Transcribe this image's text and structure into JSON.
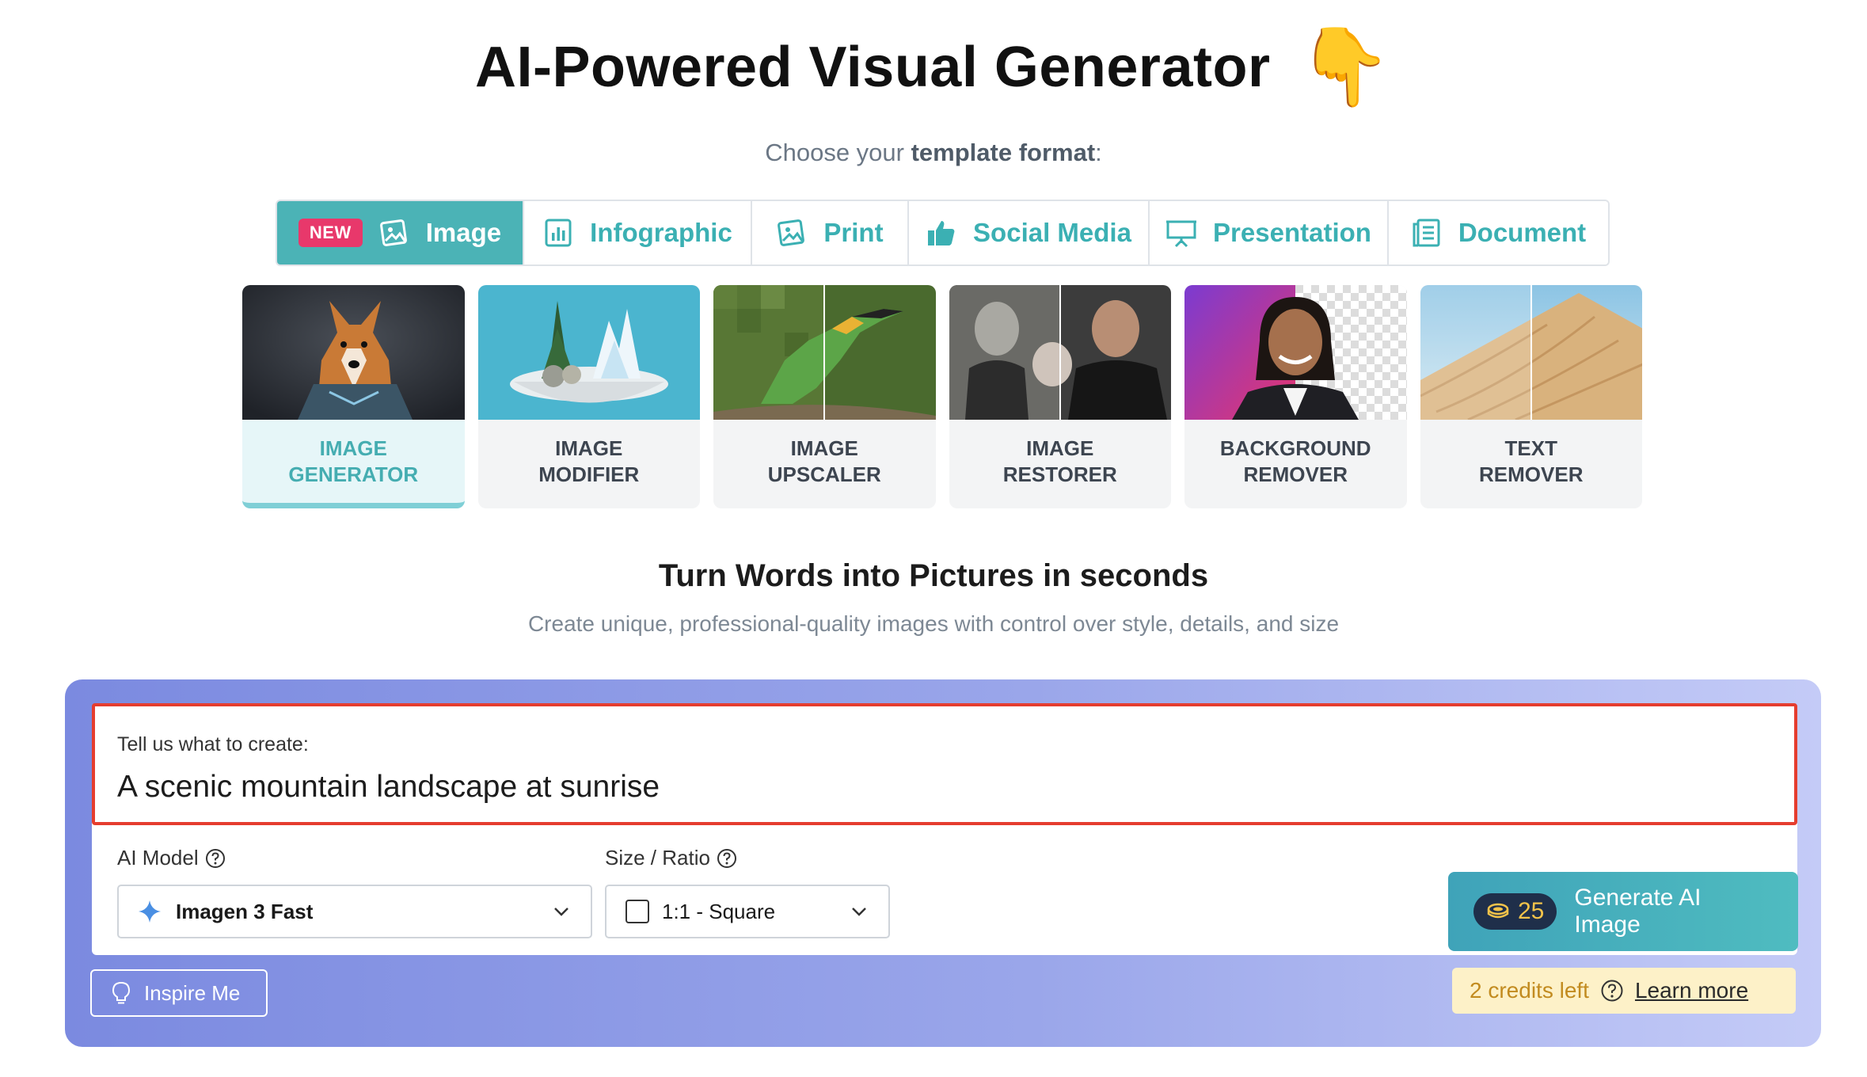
{
  "header": {
    "title": "AI-Powered Visual Generator",
    "pointer_emoji": "👇",
    "choose_prefix": "Choose your ",
    "choose_bold": "template format",
    "choose_suffix": ":"
  },
  "formats": [
    {
      "label": "Image",
      "icon": "image-icon",
      "badge": "NEW",
      "active": true
    },
    {
      "label": "Infographic",
      "icon": "bar-chart-icon"
    },
    {
      "label": "Print",
      "icon": "print-icon"
    },
    {
      "label": "Social Media",
      "icon": "thumbs-up-icon"
    },
    {
      "label": "Presentation",
      "icon": "presentation-icon"
    },
    {
      "label": "Document",
      "icon": "document-icon"
    }
  ],
  "tools": [
    {
      "label_line1": "IMAGE",
      "label_line2": "GENERATOR",
      "active": true
    },
    {
      "label_line1": "IMAGE",
      "label_line2": "MODIFIER"
    },
    {
      "label_line1": "IMAGE",
      "label_line2": "UPSCALER"
    },
    {
      "label_line1": "IMAGE",
      "label_line2": "RESTORER"
    },
    {
      "label_line1": "BACKGROUND",
      "label_line2": "REMOVER"
    },
    {
      "label_line1": "TEXT",
      "label_line2": "REMOVER"
    }
  ],
  "hero": {
    "title": "Turn Words into Pictures in seconds",
    "subtitle": "Create unique, professional-quality images with control over style, details, and size"
  },
  "form": {
    "prompt_label": "Tell us what to create:",
    "prompt_value": "A scenic mountain landscape at sunrise",
    "model_label": "AI Model",
    "model_value": "Imagen 3 Fast",
    "ratio_label": "Size / Ratio",
    "ratio_value": "1:1 - Square",
    "generate_cost": "25",
    "generate_label": "Generate AI Image",
    "inspire_label": "Inspire Me",
    "credits_text": "2 credits left",
    "learn_more": "Learn more"
  },
  "colors": {
    "accent": "#4bb3b6",
    "badge": "#e8386b",
    "highlight_border": "#e53d2f",
    "credits_bg": "#fdf1c8"
  }
}
